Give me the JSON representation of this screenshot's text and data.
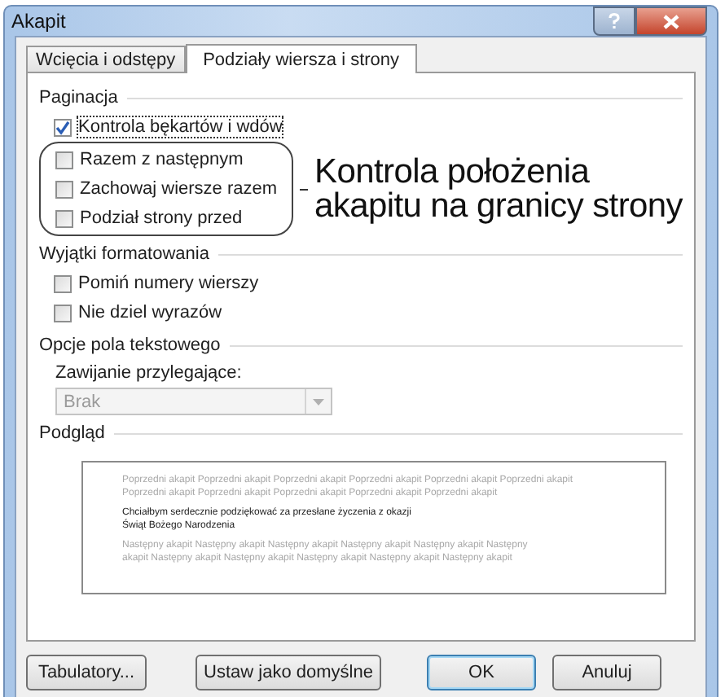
{
  "window": {
    "title": "Akapit"
  },
  "tabs": [
    {
      "label": "Wcięcia i odstępy",
      "selected": false
    },
    {
      "label": "Podziały wiersza i strony",
      "selected": true
    }
  ],
  "pagination": {
    "title": "Paginacja",
    "options": [
      {
        "label": "Kontrola bękartów i wdów",
        "checked": true,
        "focused": true
      }
    ],
    "bracketed_options": [
      {
        "label": "Razem z następnym",
        "checked": false,
        "focused": false
      },
      {
        "label": "Zachowaj wiersze razem",
        "checked": false,
        "focused": false
      },
      {
        "label": "Podział strony przed",
        "checked": false,
        "focused": false
      }
    ],
    "callout": [
      "Kontrola położenia",
      "akapitu na granicy strony"
    ]
  },
  "exceptions": {
    "title": "Wyjątki formatowania",
    "options": [
      {
        "label": "Pomiń numery wierszy",
        "checked": false
      },
      {
        "label": "Nie dziel wyrazów",
        "checked": false
      }
    ]
  },
  "textbox_options": {
    "title": "Opcje pola tekstowego",
    "label": "Zawijanie przylegające:",
    "value": "Brak",
    "disabled": true
  },
  "preview": {
    "title": "Podgląd",
    "previous": [
      "Poprzedni akapit Poprzedni akapit Poprzedni akapit Poprzedni akapit Poprzedni akapit Poprzedni akapit",
      "Poprzedni akapit Poprzedni akapit Poprzedni akapit Poprzedni akapit Poprzedni akapit"
    ],
    "current": [
      "Chciałbym serdecznie podziękować za przesłane życzenia z okazji",
      "Świąt Bożego Narodzenia"
    ],
    "next": [
      "Następny akapit Następny akapit Następny akapit Następny akapit Następny akapit Następny",
      "akapit Następny akapit Następny akapit Następny akapit Następny akapit Następny akapit"
    ]
  },
  "buttons": [
    {
      "label": "Tabulatory...",
      "default": false
    },
    {
      "label": "Ustaw jako domyślne",
      "default": false
    },
    {
      "label": "OK",
      "default": true
    },
    {
      "label": "Anuluj",
      "default": false
    }
  ]
}
